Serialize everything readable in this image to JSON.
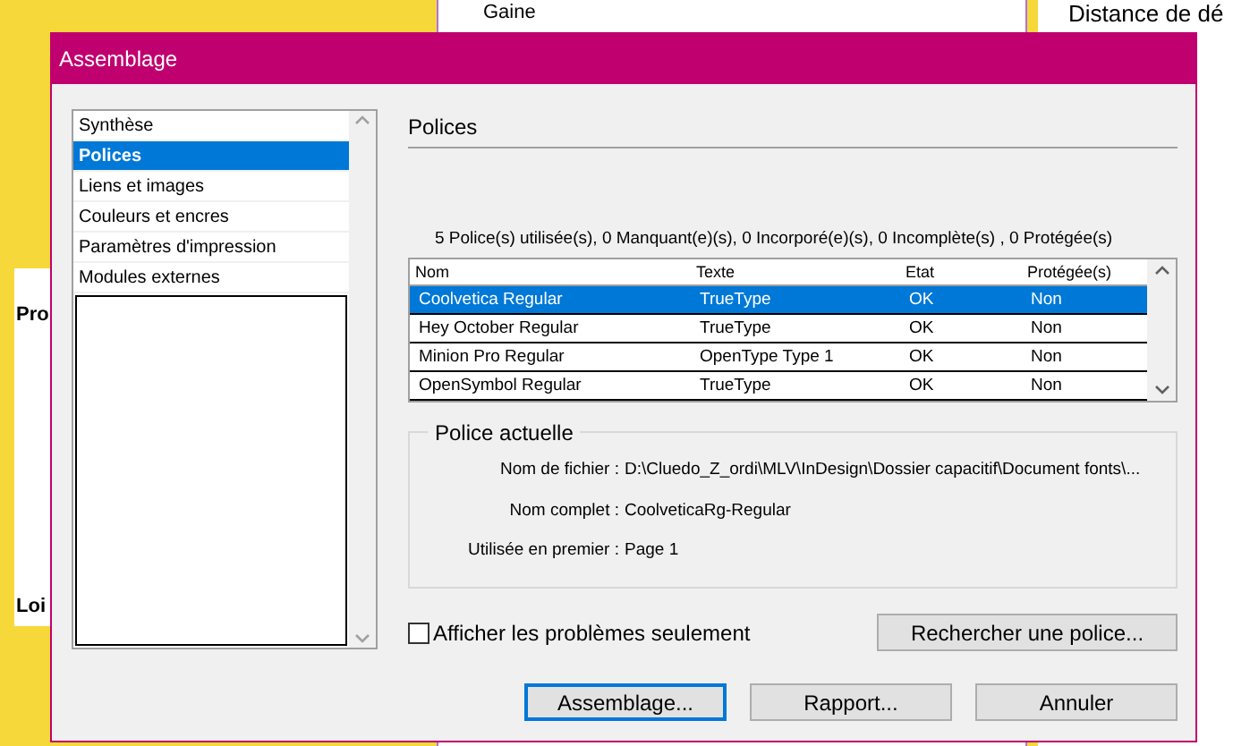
{
  "background": {
    "texts": [
      "Gaine",
      "Distance de dé",
      "Pro",
      "Loi"
    ]
  },
  "window": {
    "title": "Assemblage"
  },
  "sidebar": {
    "items": [
      {
        "label": "Synthèse",
        "selected": false
      },
      {
        "label": "Polices",
        "selected": true
      },
      {
        "label": "Liens et images",
        "selected": false
      },
      {
        "label": "Couleurs et encres",
        "selected": false
      },
      {
        "label": "Paramètres d'impression",
        "selected": false
      },
      {
        "label": "Modules externes",
        "selected": false
      }
    ]
  },
  "section_title": "Polices",
  "summary": "5 Police(s) utilisée(s), 0 Manquant(e)(s), 0 Incorporé(e)(s), 0 Incomplète(s) , 0 Protégée(s)",
  "table": {
    "columns": [
      "Nom",
      "Texte",
      "Etat",
      "Protégée(s)"
    ],
    "rows": [
      {
        "cells": [
          "Coolvetica Regular",
          "TrueType",
          "OK",
          "Non"
        ],
        "selected": true
      },
      {
        "cells": [
          "Hey October Regular",
          "TrueType",
          "OK",
          "Non"
        ],
        "selected": false
      },
      {
        "cells": [
          "Minion Pro Regular",
          "OpenType Type 1",
          "OK",
          "Non"
        ],
        "selected": false
      },
      {
        "cells": [
          "OpenSymbol Regular",
          "TrueType",
          "OK",
          "Non"
        ],
        "selected": false
      }
    ]
  },
  "current_font": {
    "title": "Police actuelle",
    "fields": [
      {
        "label": "Nom de fichier :",
        "value": "D:\\Cluedo_Z_ordi\\MLV\\InDesign\\Dossier capacitif\\Document fonts\\..."
      },
      {
        "label": "Nom complet :",
        "value": "CoolveticaRg-Regular"
      },
      {
        "label": "Utilisée en premier :",
        "value": "Page 1"
      }
    ]
  },
  "problems_only": {
    "label": "Afficher les problèmes seulement",
    "checked": false
  },
  "find_button": "Rechercher une police...",
  "buttons": [
    {
      "label": "Assemblage...",
      "selected": true
    },
    {
      "label": "Rapport...",
      "selected": false
    },
    {
      "label": "Annuler",
      "selected": false
    }
  ]
}
